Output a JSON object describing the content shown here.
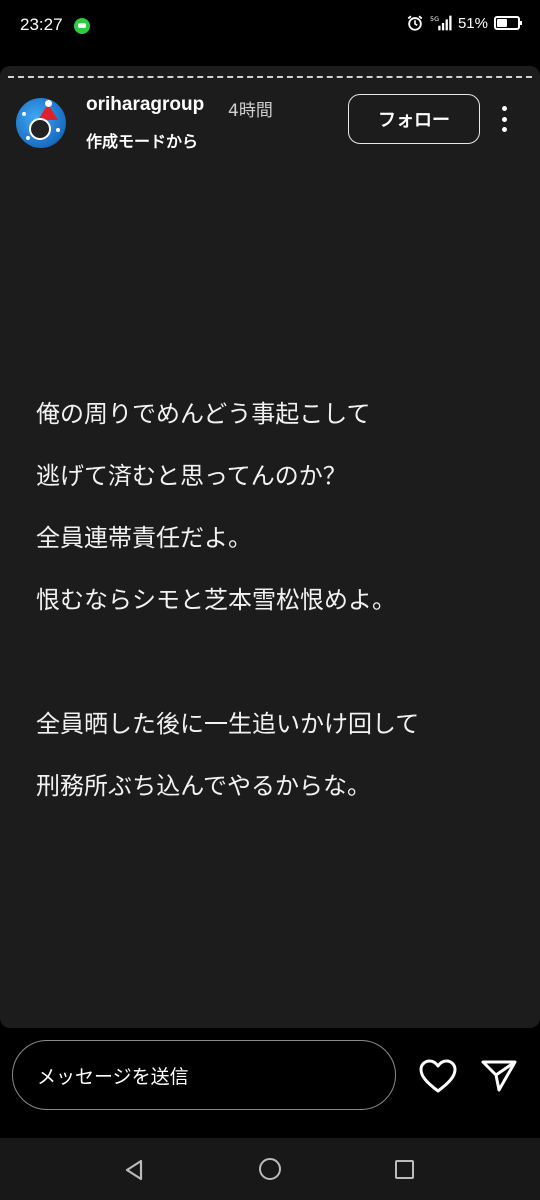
{
  "status_bar": {
    "time": "23:27",
    "line_icon": "line-app-icon",
    "alarm_icon": "alarm-icon",
    "network": "5G",
    "signal_icon": "signal-icon",
    "battery_percent": "51%",
    "battery_level": 0.51
  },
  "story": {
    "progress_segments": 1,
    "username": "oriharagroup",
    "time_ago": "4時間",
    "subtitle": "作成モードから",
    "follow_label": "フォロー",
    "more_icon": "more-vertical-icon",
    "avatar_icon": "avatar",
    "text_lines": [
      "俺の周りでめんどう事起こして",
      "逃げて済むと思ってんのか？",
      "全員連帯責任だよ。",
      "恨むならシモと芝本雪松恨めよ。",
      "",
      "全員晒した後に一生追いかけ回して",
      "刑務所ぶち込んでやるからな。"
    ]
  },
  "reply_bar": {
    "placeholder": "メッセージを送信",
    "heart_icon": "heart-icon",
    "send_icon": "send-icon"
  },
  "nav_bar": {
    "back_icon": "back-icon",
    "home_icon": "home-icon",
    "recent_icon": "recent-apps-icon"
  },
  "colors": {
    "story_background": "#1c1c1c",
    "page_background": "#000000",
    "text": "#ffffff",
    "line_green": "#2ecc40"
  }
}
